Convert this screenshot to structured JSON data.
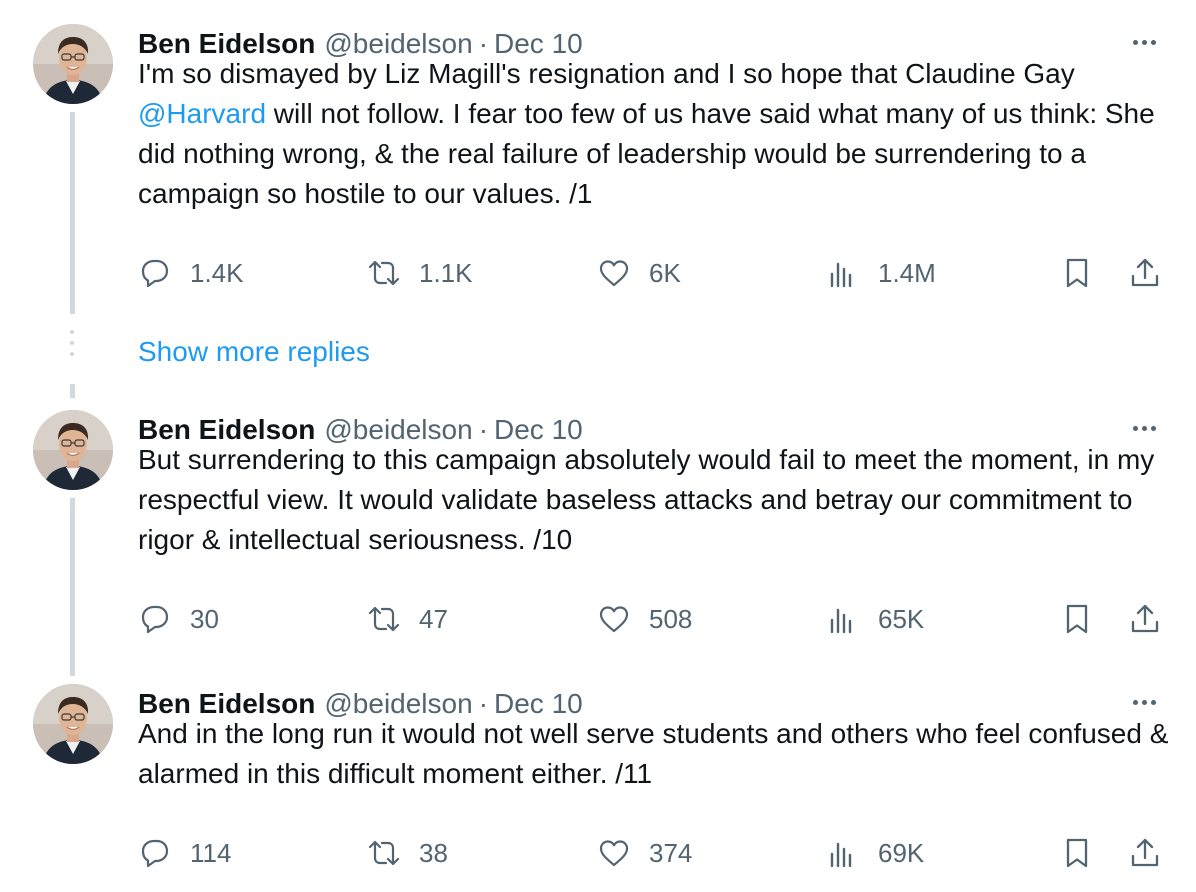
{
  "tweets": [
    {
      "name": "Ben Eidelson",
      "handle": "@beidelson",
      "separator": "·",
      "date": "Dec 10",
      "text_before": "I'm so dismayed by Liz Magill's resignation and I so hope that Claudine Gay ",
      "mention": "@Harvard",
      "text_after": " will not follow. I fear too few of us have said what many of us think: She did nothing wrong, & the real failure of leadership would be surrendering to a campaign so hostile to our values. /1",
      "replies": "1.4K",
      "reposts": "1.1K",
      "likes": "6K",
      "views": "1.4M"
    },
    {
      "name": "Ben Eidelson",
      "handle": "@beidelson",
      "separator": "·",
      "date": "Dec 10",
      "text": "But surrendering to this campaign absolutely would fail to meet the moment, in my respectful view. It would validate baseless attacks and betray our commitment to rigor & intellectual seriousness. /10",
      "replies": "30",
      "reposts": "47",
      "likes": "508",
      "views": "65K"
    },
    {
      "name": "Ben Eidelson",
      "handle": "@beidelson",
      "separator": "·",
      "date": "Dec 10",
      "text": "And in the long run it would not well serve students and others who feel confused & alarmed in this difficult moment either. /11",
      "replies": "114",
      "reposts": "38",
      "likes": "374",
      "views": "69K"
    }
  ],
  "show_more_replies": "Show more replies",
  "icons": {
    "reply": "reply-icon",
    "repost": "repost-icon",
    "like": "heart-icon",
    "views": "views-icon",
    "bookmark": "bookmark-icon",
    "share": "share-icon",
    "more": "more-icon"
  },
  "colors": {
    "link": "#1d9bf0",
    "secondary_text": "#536471",
    "thread_line": "#cfd9de"
  }
}
